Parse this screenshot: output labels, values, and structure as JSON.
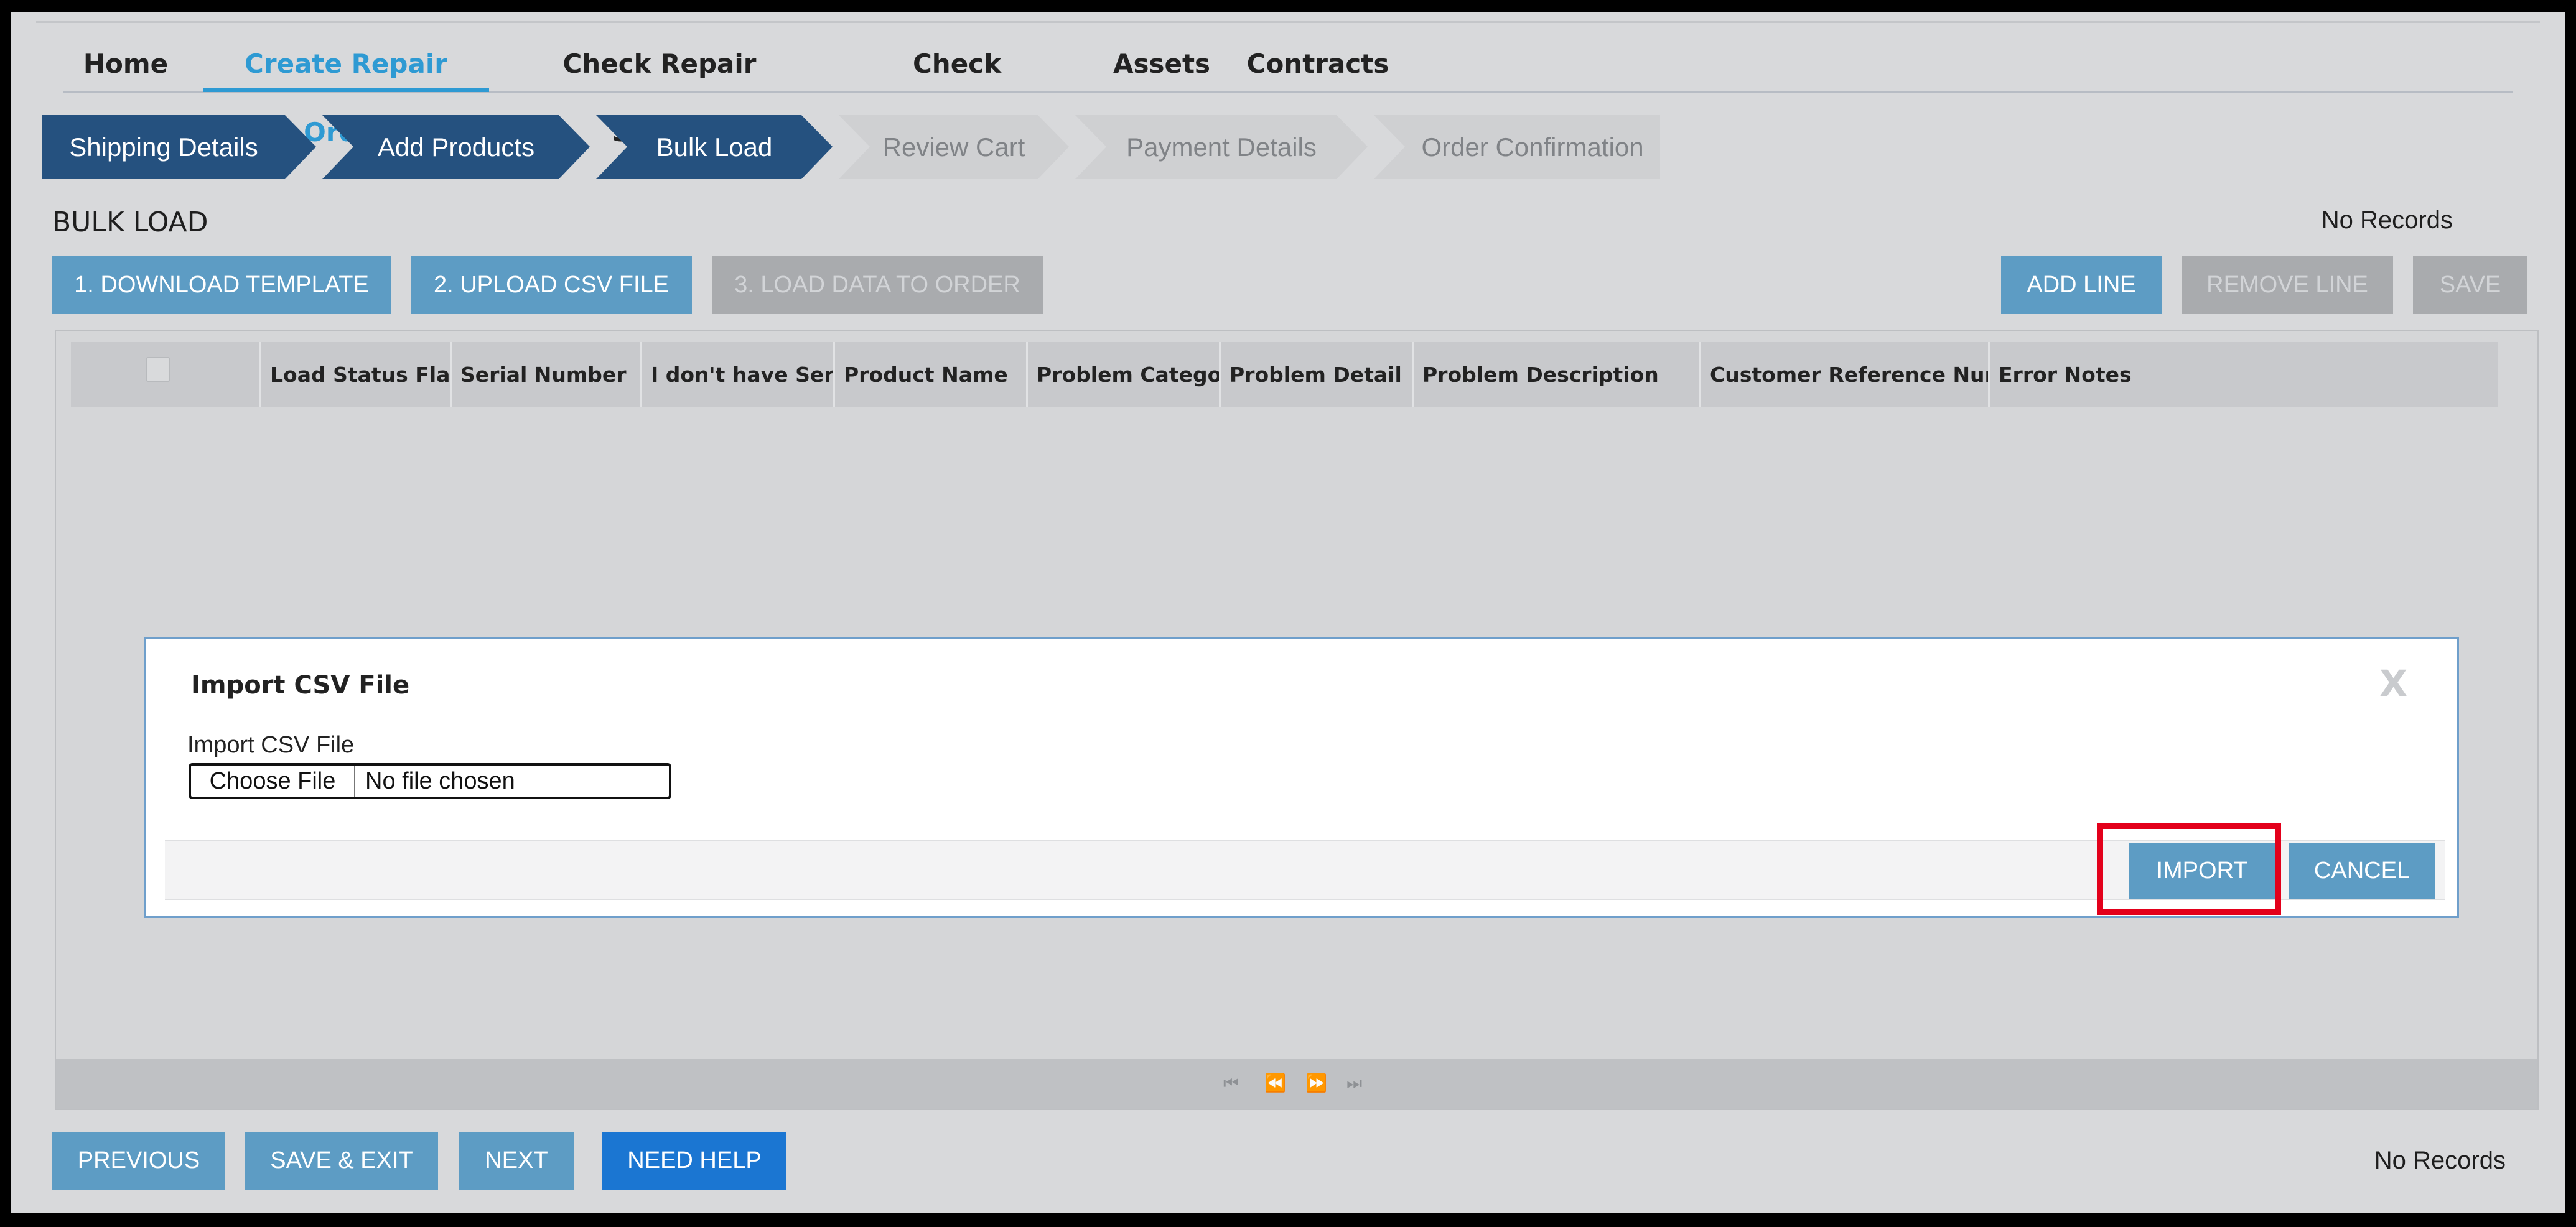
{
  "nav": {
    "items": [
      {
        "label": "Home",
        "active": false
      },
      {
        "label": "Create Repair Order",
        "active": true
      },
      {
        "label": "Check Repair Status",
        "active": false
      },
      {
        "label": "Check Entitlement",
        "active": false
      },
      {
        "label": "Assets",
        "active": false
      },
      {
        "label": "Contracts",
        "active": false
      }
    ]
  },
  "steps": [
    {
      "label": "Shipping Details",
      "state": "done"
    },
    {
      "label": "Add Products",
      "state": "done"
    },
    {
      "label": "Bulk Load",
      "state": "current"
    },
    {
      "label": "Review Cart",
      "state": "todo"
    },
    {
      "label": "Payment Details",
      "state": "todo"
    },
    {
      "label": "Order Confirmation",
      "state": "todo"
    }
  ],
  "section": {
    "title": "BULK LOAD",
    "records_top": "No Records",
    "records_bottom": "No Records"
  },
  "toolbar": {
    "download_template": "1. DOWNLOAD TEMPLATE",
    "upload_csv": "2. UPLOAD CSV FILE",
    "load_data": "3. LOAD DATA TO ORDER",
    "add_line": "ADD LINE",
    "remove_line": "REMOVE LINE",
    "save": "SAVE"
  },
  "grid": {
    "columns": [
      "Load Status Flag",
      "Serial Number",
      "I don't have Serial",
      "Product Name",
      "Problem Category",
      "Problem Detail",
      "Problem Description",
      "Customer Reference Numbe",
      "Error Notes"
    ],
    "pager": {
      "first": "⏮",
      "prev": "⏪",
      "next": "⏩",
      "last": "⏭"
    }
  },
  "modal": {
    "title": "Import CSV File",
    "close": "X",
    "field_label": "Import CSV File",
    "choose_file": "Choose File",
    "file_status": "No file chosen",
    "import": "IMPORT",
    "cancel": "CANCEL"
  },
  "footer": {
    "previous": "PREVIOUS",
    "save_exit": "SAVE & EXIT",
    "next": "NEXT",
    "need_help": "NEED HELP"
  },
  "colors": {
    "accent": "#2e9ad3",
    "step_done": "#25517f",
    "button_primary": "#5d9cc4",
    "button_help": "#1b76d2",
    "highlight": "#e3001b"
  }
}
